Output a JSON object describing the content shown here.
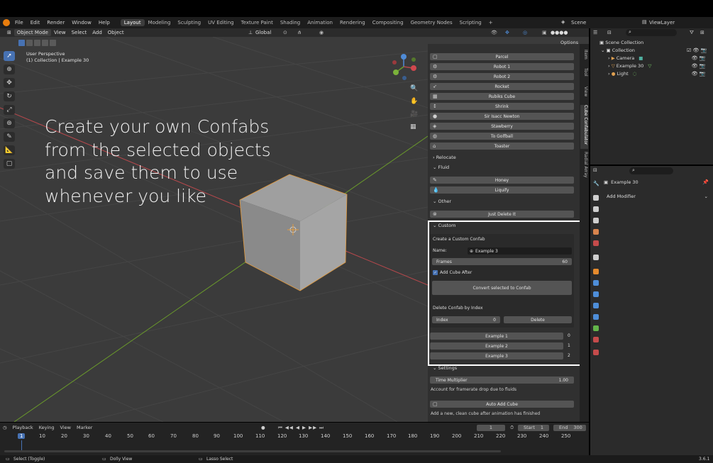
{
  "menubar": {
    "menus": [
      "File",
      "Edit",
      "Render",
      "Window",
      "Help"
    ],
    "workspaces": [
      "Layout",
      "Modeling",
      "Sculpting",
      "UV Editing",
      "Texture Paint",
      "Shading",
      "Animation",
      "Rendering",
      "Compositing",
      "Geometry Nodes",
      "Scripting"
    ],
    "active_workspace": "Layout",
    "add": "+",
    "scene": "Scene",
    "view_layer": "ViewLayer"
  },
  "header": {
    "mode": "Object Mode",
    "items": [
      "View",
      "Select",
      "Add",
      "Object"
    ],
    "orientation": "Global",
    "options": "Options"
  },
  "viewport": {
    "perspective": "User Perspective",
    "collection": "(1) Collection | Example 30",
    "overlay_lines": [
      "Create your own Confabs",
      "from the selected objects",
      "and save them to use",
      "whenever you like"
    ]
  },
  "panel": {
    "buttons": [
      "Parcel",
      "Robot 1",
      "Robot 2",
      "Rocket",
      "Rubiks Cube",
      "Shrink",
      "Sir Isacc Newton",
      "Stawberry",
      "To Golfball",
      "Toaster"
    ],
    "relocate": "Relocate",
    "fluid": "Fluid",
    "fluid_buttons": [
      "Honey",
      "Liquify"
    ],
    "other": "Other",
    "other_buttons": [
      "Just Delete It"
    ],
    "custom": "Custom",
    "create_title": "Create a Custom Confab",
    "name_label": "Name:",
    "name_value": "Example 3",
    "frames_label": "Frames",
    "frames_value": "60",
    "add_cube_after": "Add Cube After",
    "convert_button": "Convert selected to Confab",
    "delete_title": "Delete Confab by Index",
    "index_label": "Index",
    "index_value": "0",
    "delete_button": "Delete",
    "examples": [
      {
        "name": "Example 1",
        "index": "0"
      },
      {
        "name": "Example 2",
        "index": "1"
      },
      {
        "name": "Example 3",
        "index": "2"
      }
    ],
    "settings": "Settings",
    "time_multiplier_label": "Time Multiplier",
    "time_multiplier_value": "1.00",
    "framerate_note": "Account for framerate drop due to fluids",
    "auto_add_cube": "Auto Add Cube",
    "auto_add_note": "Add a new, clean cube after animation has finished"
  },
  "tabs": [
    "Item",
    "Tool",
    "View",
    "Cube Confabulator",
    "Radial Array"
  ],
  "outliner": {
    "scene_collection": "Scene Collection",
    "collection": "Collection",
    "items": [
      "Camera",
      "Example 30",
      "Light"
    ]
  },
  "properties": {
    "object_name": "Example 30",
    "add_modifier": "Add Modifier"
  },
  "timeline": {
    "menus": [
      "Playback",
      "Keying",
      "View",
      "Marker"
    ],
    "current_frame": "1",
    "start_label": "Start",
    "start_value": "1",
    "end_label": "End",
    "end_value": "300",
    "frame_numbers": [
      "1",
      "10",
      "20",
      "30",
      "40",
      "50",
      "60",
      "70",
      "80",
      "90",
      "100",
      "110",
      "120",
      "130",
      "140",
      "150",
      "160",
      "170",
      "180",
      "190",
      "200",
      "210",
      "220",
      "230",
      "240",
      "250"
    ]
  },
  "status": {
    "select": "Select (Toggle)",
    "dolly": "Dolly View",
    "lasso": "Lasso Select",
    "version": "3.6.1"
  },
  "colors": {
    "accent": "#4772b3",
    "highlight_border": "#ffffff",
    "x_axis": "#b8484c",
    "y_axis": "#6a9a2b"
  }
}
